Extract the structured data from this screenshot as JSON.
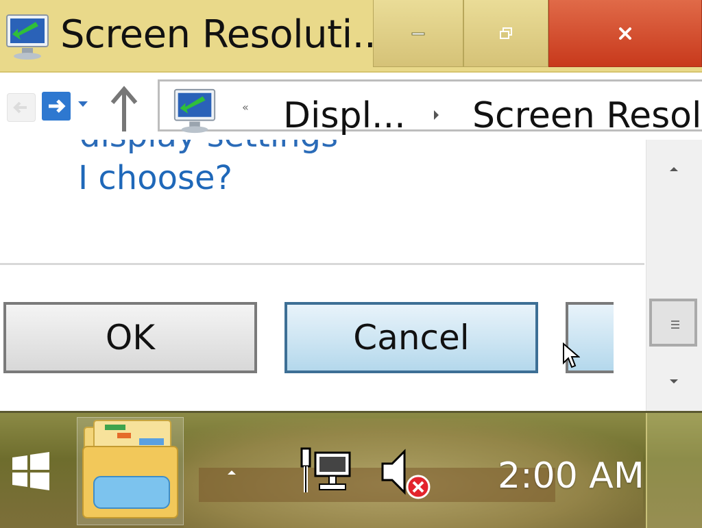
{
  "window": {
    "title": "Screen Resoluti...",
    "controls": {
      "minimize": "minimize",
      "maximize": "restore",
      "close": "close"
    }
  },
  "address_bar": {
    "overflow_chevron": "«",
    "breadcrumbs": [
      "Displ...",
      "Screen Resol"
    ]
  },
  "content": {
    "cutoff_text": "display settings",
    "help_link": "I choose?",
    "buttons": {
      "ok": "OK",
      "cancel": "Cancel",
      "apply": ""
    }
  },
  "taskbar": {
    "clock": "2:00 AM",
    "tray_icons": [
      "network-icon",
      "volume-muted-icon"
    ],
    "pinned": [
      "file-explorer"
    ]
  },
  "colors": {
    "titlebar": "#e9d98a",
    "close_button": "#d04a2a",
    "link": "#1f68b9",
    "focused_button_border": "#3d6f95"
  }
}
